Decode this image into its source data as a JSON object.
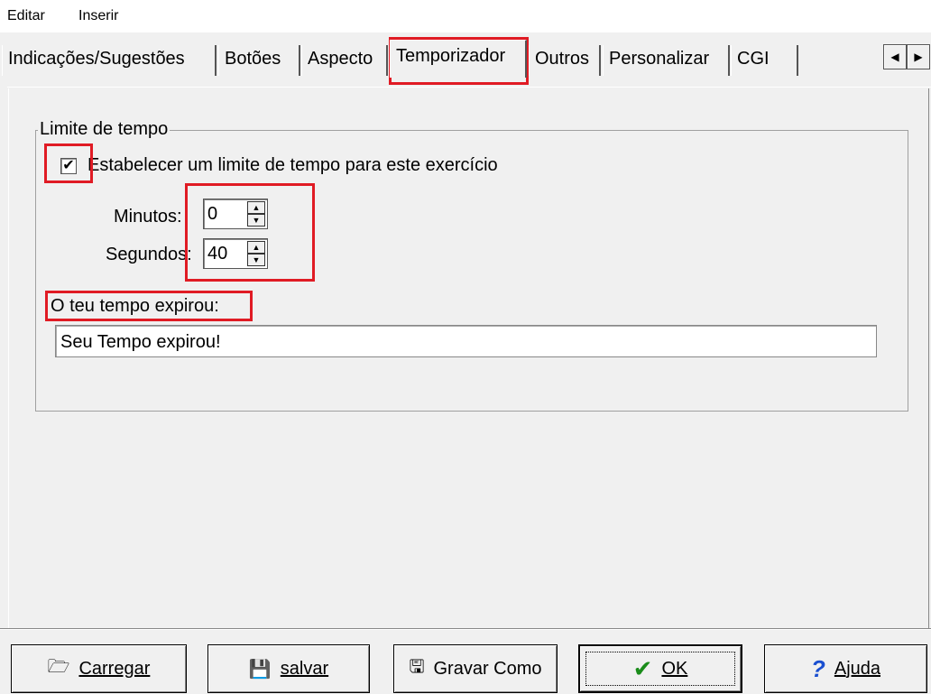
{
  "menu": {
    "items": [
      "Editar",
      "Inserir"
    ]
  },
  "tabs": [
    {
      "label": "Indicações/Sugestões"
    },
    {
      "label": "Botões"
    },
    {
      "label": "Aspecto"
    },
    {
      "label": "Temporizador"
    },
    {
      "label": "Outros"
    },
    {
      "label": "Personalizar"
    },
    {
      "label": "CGI"
    }
  ],
  "active_tab": "Temporizador",
  "tab_scroll": {
    "left_icon": "◀",
    "right_icon": "▶"
  },
  "timer": {
    "group_title": "Limite de tempo",
    "checkbox_label": "Estabelecer um limite de tempo para este exercício",
    "checkbox_checked": true,
    "check_glyph": "✔",
    "minutes_label": "Minutos:",
    "minutes_value": "0",
    "seconds_label": "Segundos:",
    "seconds_value": "40",
    "spin_up": "▲",
    "spin_down": "▼",
    "expired_label": "O teu tempo expirou:",
    "expired_message": "Seu Tempo expirou!"
  },
  "buttons": {
    "load": {
      "label": "Carregar",
      "icon": "folder-open-icon",
      "glyph": "🗁"
    },
    "save": {
      "label": "salvar",
      "icon": "floppy-disk-icon",
      "glyph": "💾"
    },
    "save_as": {
      "label": "Gravar Como",
      "icon": "save-as-icon",
      "glyph": "🖫"
    },
    "ok": {
      "label": "OK",
      "icon": "checkmark-icon",
      "glyph": "✔"
    },
    "help": {
      "label": "Ajuda",
      "icon": "question-mark-icon",
      "glyph": "?"
    }
  },
  "colors": {
    "highlight": "#e01b24",
    "ok_check": "#1a8c1a",
    "help_icon": "#1a4fd0"
  }
}
